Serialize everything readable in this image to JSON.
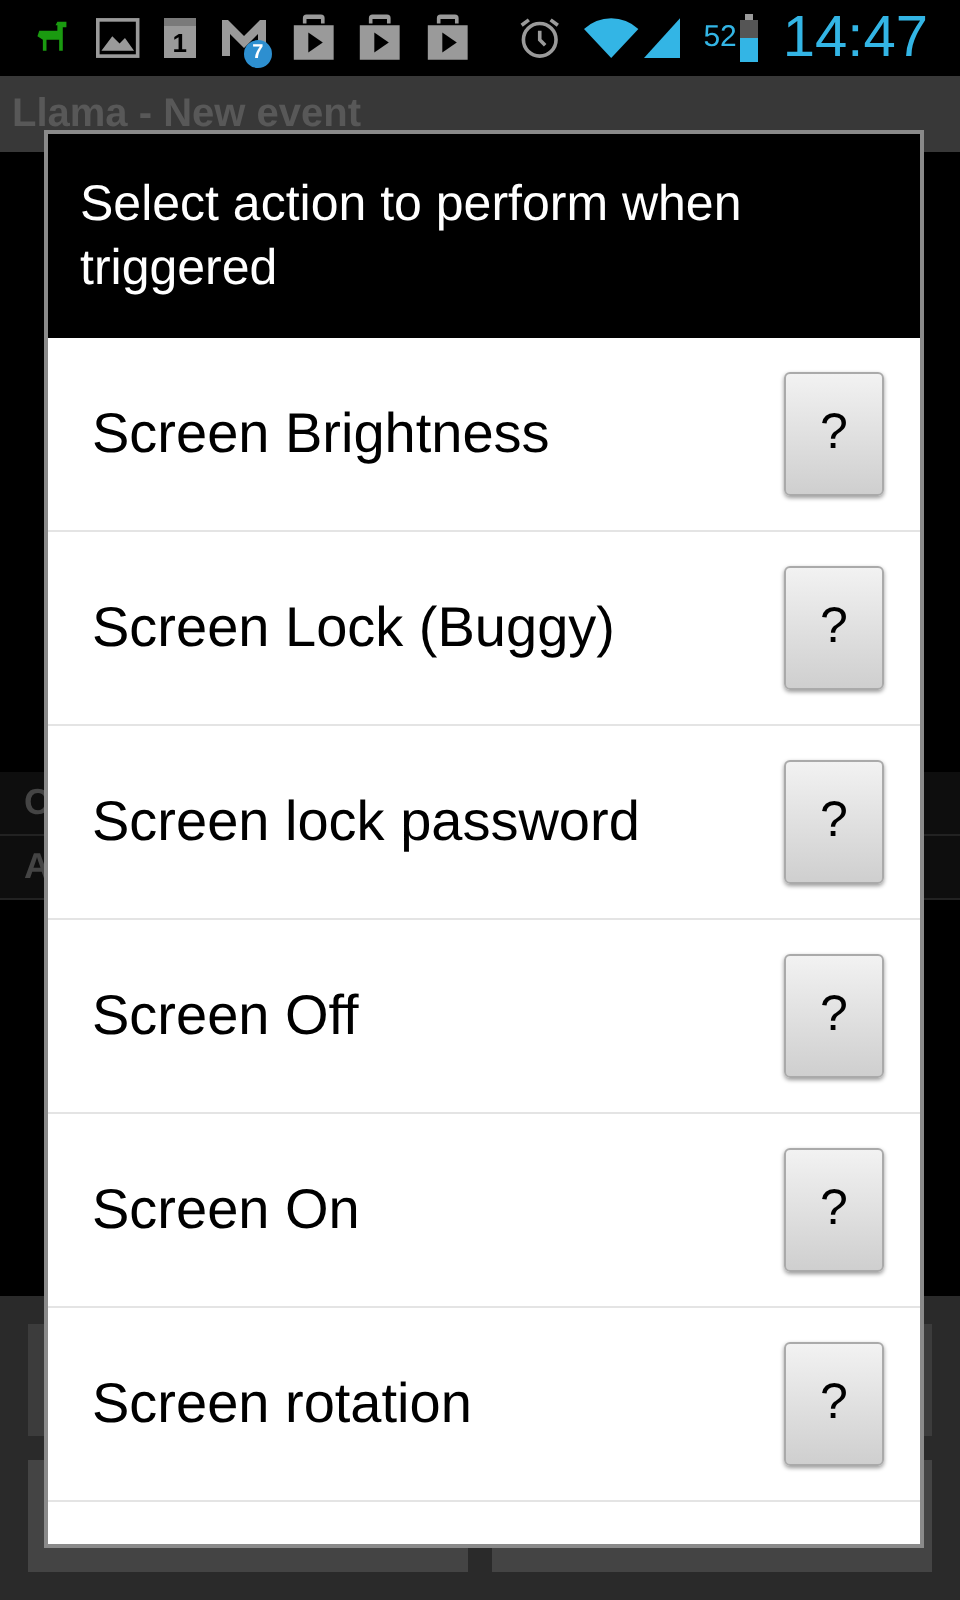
{
  "status_bar": {
    "calendar_day": "1",
    "mail_count": "7",
    "battery": "52",
    "time": "14:47"
  },
  "app_bar": {
    "title": "Llama - New event"
  },
  "background_rows": [
    "C",
    "A"
  ],
  "dialog": {
    "title": "Select action to perform when triggered",
    "items": [
      {
        "label": "Screen Brightness",
        "help": "?"
      },
      {
        "label": "Screen Lock (Buggy)",
        "help": "?"
      },
      {
        "label": "Screen lock password",
        "help": "?"
      },
      {
        "label": "Screen Off",
        "help": "?"
      },
      {
        "label": "Screen On",
        "help": "?"
      },
      {
        "label": "Screen rotation",
        "help": "?"
      }
    ]
  }
}
